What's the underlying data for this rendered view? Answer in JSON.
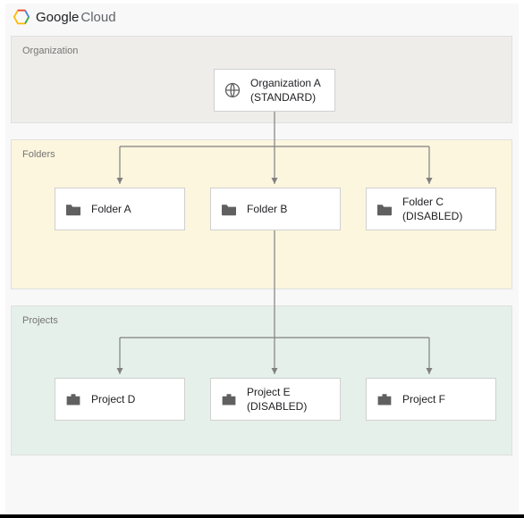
{
  "brand": {
    "google": "Google",
    "cloud": "Cloud"
  },
  "zones": {
    "organization": "Organization",
    "folders": "Folders",
    "projects": "Projects"
  },
  "org": {
    "name": "Organization A",
    "tier": "(STANDARD)"
  },
  "folders": {
    "a": {
      "name": "Folder A"
    },
    "b": {
      "name": "Folder B"
    },
    "c": {
      "name": "Folder C",
      "state": "(DISABLED)"
    }
  },
  "projects": {
    "d": {
      "name": "Project D"
    },
    "e": {
      "name": "Project E",
      "state": "(DISABLED)"
    },
    "f": {
      "name": "Project F"
    }
  },
  "hierarchy": {
    "organization_children": [
      "Folder A",
      "Folder B",
      "Folder C"
    ],
    "folder_b_children": [
      "Project D",
      "Project E",
      "Project F"
    ]
  },
  "colors": {
    "org_zone": "#eeede9",
    "folders_zone": "#fcf6de",
    "projects_zone": "#e6f0eb",
    "node_border": "#d0d0d0",
    "icon_dark": "#606060",
    "line": "#808080"
  }
}
